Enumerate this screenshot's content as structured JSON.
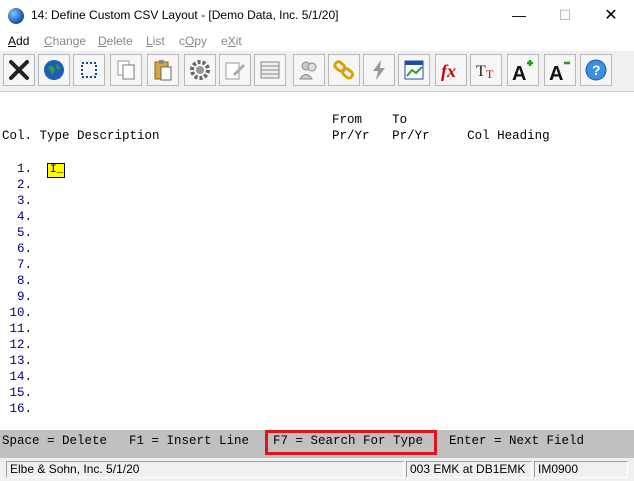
{
  "window": {
    "title": "14: Define Custom CSV Layout - [Demo Data, Inc. 5/1/20]",
    "minimize_glyph": "—",
    "maximize_glyph": "☐",
    "close_glyph": "✕"
  },
  "menu": [
    {
      "label": "Add",
      "accel": "A",
      "rest": "dd",
      "enabled": true
    },
    {
      "label": "Change",
      "accel": "C",
      "rest": "hange",
      "enabled": false
    },
    {
      "label": "Delete",
      "accel": "D",
      "rest": "elete",
      "enabled": false
    },
    {
      "label": "List",
      "accel": "L",
      "rest": "ist",
      "enabled": false
    },
    {
      "label": "cOpy",
      "pre": "c",
      "accel": "O",
      "rest": "py",
      "enabled": false
    },
    {
      "label": "eXit",
      "pre": "e",
      "accel": "X",
      "rest": "it",
      "enabled": false
    }
  ],
  "toolbar_icons": [
    "cancel-icon",
    "globe-icon",
    "select-icon",
    "copy-icon",
    "paste-icon",
    "settings-icon",
    "edit-icon",
    "table-icon",
    "users-icon",
    "link-icon",
    "lightning-icon",
    "chart-icon",
    "function-icon",
    "font-size-icon",
    "font-increase-icon",
    "font-decrease-icon",
    "help-icon"
  ],
  "header": {
    "line1": "                                            From    To",
    "line2": "Col. Type Description                       Pr/Yr   Pr/Yr     Col Heading"
  },
  "rows": [
    "  1.",
    "  2.",
    "  3.",
    "  4.",
    "  5.",
    "  6.",
    "  7.",
    "  8.",
    "  9.",
    " 10.",
    " 11.",
    " 12.",
    " 13.",
    " 14.",
    " 15.",
    " 16."
  ],
  "current_input": "I_",
  "help": {
    "space": "Space = Delete",
    "f1": "F1 = Insert Line",
    "f7": "F7 = Search For Type",
    "enter": "Enter = Next Field"
  },
  "status": {
    "company": "Elbe & Sohn, Inc. 5/1/20",
    "user": "003 EMK at DB1EMK",
    "program": "IM0900"
  },
  "colors": {
    "highlight_border": "#e0141e",
    "input_bg": "#ffff00",
    "row_number": "#000080",
    "help_bg": "#c0c0c0"
  }
}
